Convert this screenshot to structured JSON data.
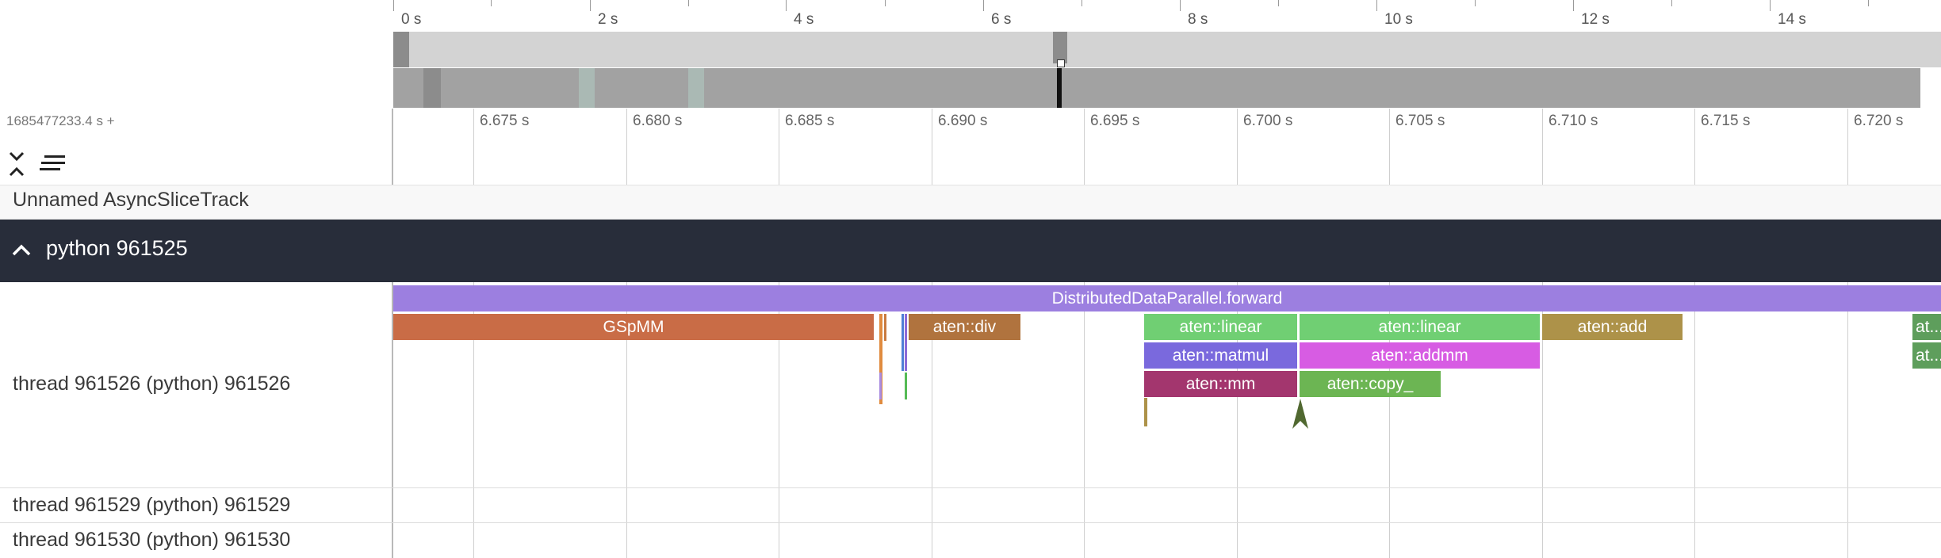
{
  "overview": {
    "ticks": [
      "0 s",
      "2 s",
      "4 s",
      "6 s",
      "8 s",
      "10 s",
      "12 s",
      "14 s"
    ]
  },
  "timeline": {
    "offset_label": "1685477233.4 s +",
    "ticks": [
      "6.675 s",
      "6.680 s",
      "6.685 s",
      "6.690 s",
      "6.695 s",
      "6.700 s",
      "6.705 s",
      "6.710 s",
      "6.715 s",
      "6.720 s"
    ]
  },
  "toolbar": {
    "collapse_icon": "collapse-all-icon",
    "filter_icon": "lines-icon"
  },
  "tracks": {
    "async_track": "Unnamed AsyncSliceTrack",
    "group": {
      "title": "python 961525",
      "icon": "chevron-up-icon"
    },
    "thread_main": "thread 961526 (python) 961526",
    "thread_b": "thread 961529 (python) 961529",
    "thread_c": "thread 961530 (python) 961530"
  },
  "slices": {
    "ddp_forward": "DistributedDataParallel.forward",
    "gspmm": "GSpMM",
    "div": "aten::div",
    "linear1": "aten::linear",
    "linear2": "aten::linear",
    "add": "aten::add",
    "at_truncated_1": "at...",
    "at_truncated_2": "at...",
    "matmul": "aten::matmul",
    "addmm": "aten::addmm",
    "mm": "aten::mm",
    "copy": "aten::copy_"
  },
  "colors": {
    "ddp_forward": "#9c7fe0",
    "gspmm": "#c96c46",
    "div": "#b0733e",
    "linear": "#70cf73",
    "add": "#ad9249",
    "at_green": "#5e9e5c",
    "matmul": "#7a69dd",
    "addmm": "#d75ce3",
    "mm": "#a3366e",
    "copy": "#6cb553",
    "group_header": "#282d3a"
  }
}
